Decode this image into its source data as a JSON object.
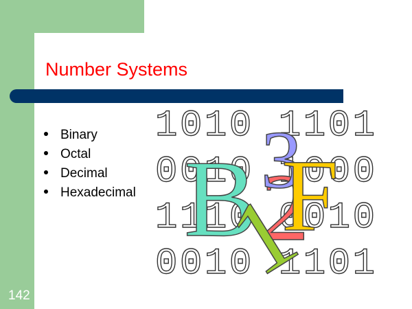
{
  "slide": {
    "title": "Number Systems",
    "bullets": [
      "Binary",
      "Octal",
      "Decimal",
      "Hexadecimal"
    ],
    "page_number": "142"
  },
  "clipart": {
    "binary_rows": [
      "1010 1101",
      "0010 1000",
      "1110 0010",
      "0010 1101"
    ],
    "glyphs": [
      "3",
      "B",
      "2",
      "F",
      "1"
    ],
    "colors": {
      "three": "#9999ff",
      "b": "#66e0c0",
      "two": "#ff6666",
      "f": "#ffcc00",
      "one": "#99cc33"
    }
  },
  "theme": {
    "accent_green": "#99cc99",
    "title_red": "#ff0000",
    "rule_navy": "#003366"
  }
}
